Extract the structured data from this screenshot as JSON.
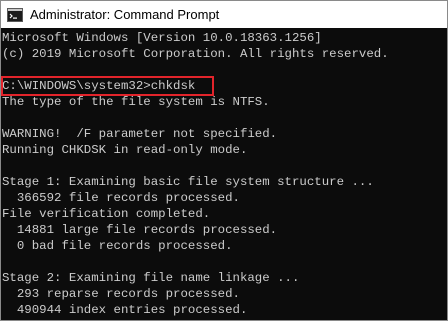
{
  "window": {
    "title": "Administrator: Command Prompt",
    "icon": "cmd-icon"
  },
  "console": {
    "lines": [
      "Microsoft Windows [Version 10.0.18363.1256]",
      "(c) 2019 Microsoft Corporation. All rights reserved.",
      "",
      "C:\\WINDOWS\\system32>chkdsk",
      "The type of the file system is NTFS.",
      "",
      "WARNING!  /F parameter not specified.",
      "Running CHKDSK in read-only mode.",
      "",
      "Stage 1: Examining basic file system structure ...",
      "  366592 file records processed.",
      "File verification completed.",
      "  14881 large file records processed.",
      "  0 bad file records processed.",
      "",
      "Stage 2: Examining file name linkage ...",
      "  293 reparse records processed.",
      "  490944 index entries processed."
    ],
    "highlighted_command": "C:\\WINDOWS\\system32>chkdsk"
  },
  "colors": {
    "console_background": "#0c0c0c",
    "console_text": "#cccccc",
    "highlight_border": "#e3242b",
    "titlebar_background": "#ffffff"
  }
}
